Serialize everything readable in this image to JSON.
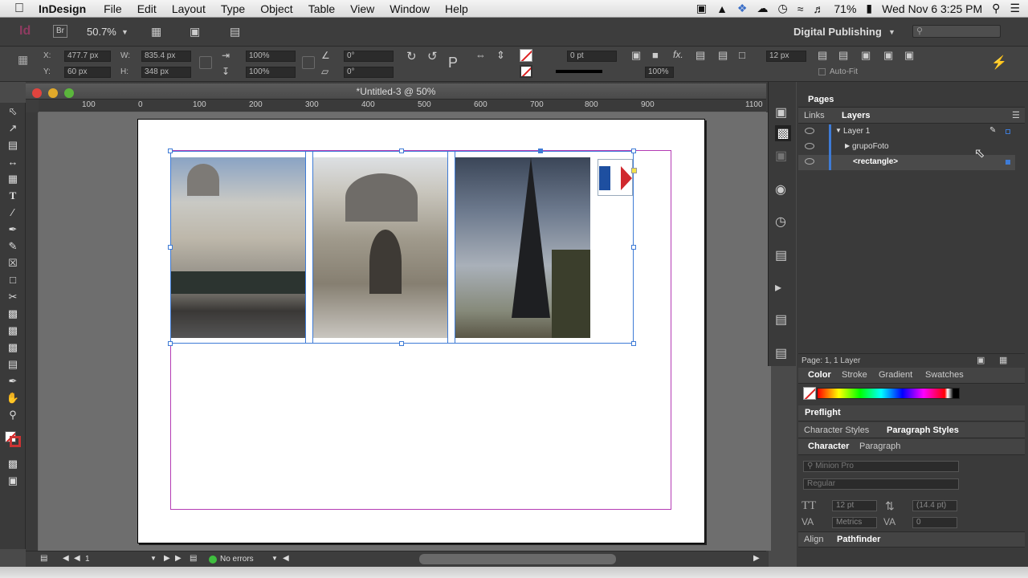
{
  "menubar": {
    "app_name": "InDesign",
    "menus": [
      "File",
      "Edit",
      "Layout",
      "Type",
      "Object",
      "Table",
      "View",
      "Window",
      "Help"
    ],
    "battery": "71%",
    "datetime": "Wed Nov 6  3:25 PM"
  },
  "appbar": {
    "logo": "Id",
    "bridge": "Br",
    "zoom": "50.7%",
    "workspace": "Digital Publishing"
  },
  "control": {
    "x_label": "X:",
    "x_value": "477.7 px",
    "y_label": "Y:",
    "y_value": "60 px",
    "w_label": "W:",
    "w_value": "835.4 px",
    "h_label": "H:",
    "h_value": "348 px",
    "scale_x": "100%",
    "scale_y": "100%",
    "angle": "0°",
    "shear": "0°",
    "stroke_weight": "0 pt",
    "opacity": "100%",
    "gap": "12 px",
    "auto_fit": "Auto-Fit"
  },
  "document": {
    "title": "*Untitled-3 @ 50%",
    "ruler_h": [
      "100",
      "0",
      "100",
      "200",
      "300",
      "400",
      "500",
      "600",
      "700",
      "800",
      "900",
      "1100"
    ],
    "page_number": "1",
    "preflight": "No errors"
  },
  "panels": {
    "pages_tab": "Pages",
    "links_tab": "Links",
    "layers_tab": "Layers",
    "layers": [
      {
        "name": "Layer 1",
        "indent": 0,
        "expanded": true
      },
      {
        "name": "grupoFoto",
        "indent": 1,
        "expanded": false
      },
      {
        "name": "<rectangle>",
        "indent": 1,
        "selected": true
      }
    ],
    "layers_footer": "Page: 1, 1 Layer",
    "color_tabs": [
      "Color",
      "Stroke",
      "Gradient",
      "Swatches"
    ],
    "preflight_tab": "Preflight",
    "style_tabs": [
      "Character Styles",
      "Paragraph Styles"
    ],
    "char_tabs": [
      "Character",
      "Paragraph"
    ],
    "font_family": "Minion Pro",
    "font_style": "Regular",
    "font_size": "12 pt",
    "leading": "(14.4 pt)",
    "kerning": "Metrics",
    "tracking": "0",
    "bottom_tabs": [
      "Align",
      "Pathfinder"
    ]
  },
  "colors": {
    "accent_frame": "#3e7bd6",
    "margin_guide": "#b43cb4",
    "app_bg": "#3d3d3d"
  }
}
